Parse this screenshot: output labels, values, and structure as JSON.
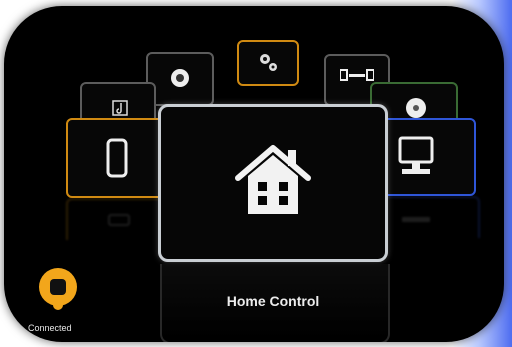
{
  "menu": {
    "selected_label": "Home Control",
    "items": [
      {
        "icon": "music-icon"
      },
      {
        "icon": "camera-icon"
      },
      {
        "icon": "settings-icon"
      },
      {
        "icon": "sliders-icon"
      },
      {
        "icon": "disc-icon"
      },
      {
        "icon": "phone-icon"
      },
      {
        "icon": "house-icon"
      },
      {
        "icon": "monitor-icon"
      }
    ]
  },
  "status": {
    "label": "Connected",
    "icon": "connection-icon",
    "color": "#f2a61b"
  },
  "colors": {
    "background": "#000000",
    "selected_border": "#c9ced3",
    "phone_border": "#d08a12",
    "monitor_border": "#2f56d8",
    "settings_border": "#d08a12",
    "disc_border": "#3a6b34"
  }
}
